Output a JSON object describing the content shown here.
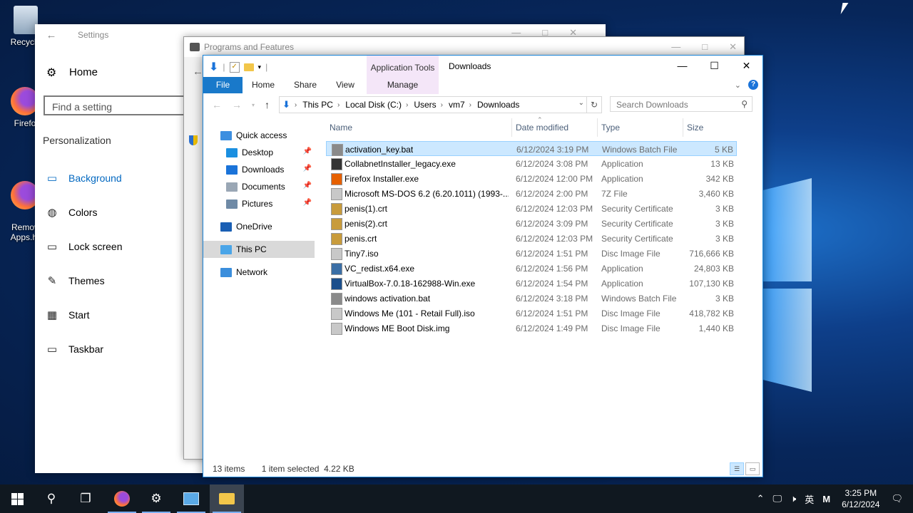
{
  "desktop": {
    "icons": [
      {
        "label": "Recycle"
      },
      {
        "label": "Firefo"
      },
      {
        "label": "Remov\nApps.ht"
      }
    ]
  },
  "settings": {
    "title": "Settings",
    "home": "Home",
    "search_placeholder": "Find a setting",
    "section": "Personalization",
    "nav": [
      {
        "label": "Background",
        "icon": "image-icon",
        "glyph": "▭"
      },
      {
        "label": "Colors",
        "icon": "palette-icon",
        "glyph": "◍"
      },
      {
        "label": "Lock screen",
        "icon": "lock-screen-icon",
        "glyph": "▭"
      },
      {
        "label": "Themes",
        "icon": "brush-icon",
        "glyph": "✎"
      },
      {
        "label": "Start",
        "icon": "start-icon",
        "glyph": "▦"
      },
      {
        "label": "Taskbar",
        "icon": "taskbar-icon",
        "glyph": "▭"
      }
    ]
  },
  "programs": {
    "title": "Programs and Features"
  },
  "explorer": {
    "app_tools": "Application Tools",
    "title": "Downloads",
    "tabs": {
      "file": "File",
      "home": "Home",
      "share": "Share",
      "view": "View",
      "manage": "Manage"
    },
    "address": [
      "This PC",
      "Local Disk (C:)",
      "Users",
      "vm7",
      "Downloads"
    ],
    "search_placeholder": "Search Downloads",
    "nav": [
      {
        "label": "Quick access",
        "icon": "star-icon",
        "color": "#3d8fe0",
        "pin": false,
        "indent": 24
      },
      {
        "label": "Desktop",
        "icon": "desktop-folder-icon",
        "color": "#1a8fe0",
        "pin": true,
        "indent": 32
      },
      {
        "label": "Downloads",
        "icon": "downloads-folder-icon",
        "color": "#1a73d9",
        "pin": true,
        "indent": 32
      },
      {
        "label": "Documents",
        "icon": "documents-folder-icon",
        "color": "#9aa7b5",
        "pin": true,
        "indent": 32
      },
      {
        "label": "Pictures",
        "icon": "pictures-folder-icon",
        "color": "#6f8aa6",
        "pin": true,
        "indent": 32
      },
      {
        "label": "OneDrive",
        "icon": "onedrive-icon",
        "color": "#1a5fb4",
        "pin": false,
        "indent": 24
      },
      {
        "label": "This PC",
        "icon": "this-pc-icon",
        "color": "#4aa5e8",
        "pin": false,
        "indent": 24
      },
      {
        "label": "Network",
        "icon": "network-icon",
        "color": "#3b8edc",
        "pin": false,
        "indent": 24
      }
    ],
    "columns": {
      "name": "Name",
      "date": "Date modified",
      "type": "Type",
      "size": "Size"
    },
    "files": [
      {
        "name": "activation_key.bat",
        "date": "6/12/2024 3:19 PM",
        "type": "Windows Batch File",
        "size": "5 KB",
        "icon": "batch-file-icon",
        "color": "#8a8a8a"
      },
      {
        "name": "CollabnetInstaller_legacy.exe",
        "date": "6/12/2024 3:08 PM",
        "type": "Application",
        "size": "13 KB",
        "icon": "installer-icon",
        "color": "#333333"
      },
      {
        "name": "Firefox Installer.exe",
        "date": "6/12/2024 12:00 PM",
        "type": "Application",
        "size": "342 KB",
        "icon": "firefox-icon",
        "color": "#e66000"
      },
      {
        "name": "Microsoft MS-DOS 6.2 (6.20.1011) (1993-...",
        "date": "6/12/2024 2:00 PM",
        "type": "7Z File",
        "size": "3,460 KB",
        "icon": "archive-file-icon",
        "color": "#c8c8c8"
      },
      {
        "name": "penis(1).crt",
        "date": "6/12/2024 12:03 PM",
        "type": "Security Certificate",
        "size": "3 KB",
        "icon": "certificate-icon",
        "color": "#c89b3c"
      },
      {
        "name": "penis(2).crt",
        "date": "6/12/2024 3:09 PM",
        "type": "Security Certificate",
        "size": "3 KB",
        "icon": "certificate-icon",
        "color": "#c89b3c"
      },
      {
        "name": "penis.crt",
        "date": "6/12/2024 12:03 PM",
        "type": "Security Certificate",
        "size": "3 KB",
        "icon": "certificate-icon",
        "color": "#c89b3c"
      },
      {
        "name": "Tiny7.iso",
        "date": "6/12/2024 1:51 PM",
        "type": "Disc Image File",
        "size": "716,666 KB",
        "icon": "disc-image-icon",
        "color": "#c8c8c8"
      },
      {
        "name": "VC_redist.x64.exe",
        "date": "6/12/2024 1:56 PM",
        "type": "Application",
        "size": "24,803 KB",
        "icon": "setup-icon",
        "color": "#3a6ea5"
      },
      {
        "name": "VirtualBox-7.0.18-162988-Win.exe",
        "date": "6/12/2024 1:54 PM",
        "type": "Application",
        "size": "107,130 KB",
        "icon": "virtualbox-icon",
        "color": "#1c4f8c"
      },
      {
        "name": "windows activation.bat",
        "date": "6/12/2024 3:18 PM",
        "type": "Windows Batch File",
        "size": "3 KB",
        "icon": "batch-file-icon",
        "color": "#8a8a8a"
      },
      {
        "name": "Windows Me (101 - Retail Full).iso",
        "date": "6/12/2024 1:51 PM",
        "type": "Disc Image File",
        "size": "418,782 KB",
        "icon": "disc-image-icon",
        "color": "#c8c8c8"
      },
      {
        "name": "Windows ME Boot Disk.img",
        "date": "6/12/2024 1:49 PM",
        "type": "Disc Image File",
        "size": "1,440 KB",
        "icon": "disc-image-icon",
        "color": "#c8c8c8"
      }
    ],
    "status": {
      "count": "13 items",
      "selected": "1 item selected  4.22 KB"
    }
  },
  "taskbar": {
    "ime": "英",
    "ime2": "M",
    "time": "3:25 PM",
    "date": "6/12/2024"
  }
}
